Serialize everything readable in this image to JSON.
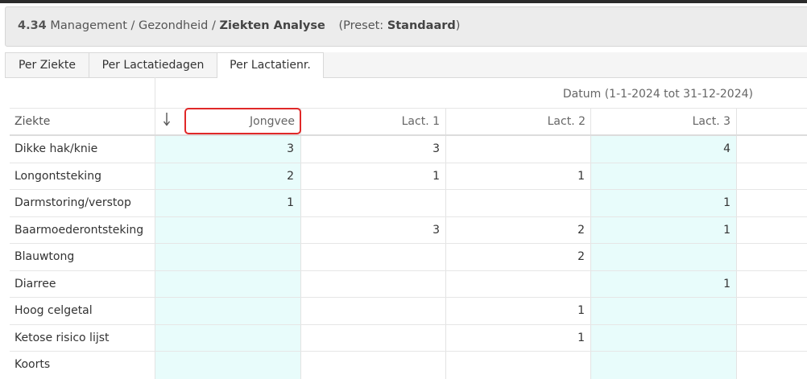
{
  "breadcrumb": {
    "number": "4.34",
    "section": "Management / Gezondheid /",
    "page": "Ziekten Analyse",
    "preset_prefix": "(Preset:",
    "preset_value": "Standaard",
    "preset_suffix": ")"
  },
  "tabs": [
    {
      "label": "Per Ziekte",
      "active": false
    },
    {
      "label": "Per Lactatiedagen",
      "active": false
    },
    {
      "label": "Per Lactatienr.",
      "active": true
    }
  ],
  "table": {
    "group_header": "Datum (1-1-2024 tot 31-12-2024)",
    "row_header": "Ziekte",
    "sort_icon": "arrow-down-icon",
    "columns": [
      "Jongvee",
      "Lact. 1",
      "Lact. 2",
      "Lact. 3"
    ],
    "rows": [
      {
        "label": "Dikke hak/knie",
        "values": [
          "3",
          "3",
          "",
          "4"
        ]
      },
      {
        "label": "Longontsteking",
        "values": [
          "2",
          "1",
          "1",
          ""
        ]
      },
      {
        "label": "Darmstoring/verstop",
        "values": [
          "1",
          "",
          "",
          "1"
        ]
      },
      {
        "label": "Baarmoederontsteking",
        "values": [
          "",
          "3",
          "2",
          "1"
        ]
      },
      {
        "label": "Blauwtong",
        "values": [
          "",
          "",
          "2",
          ""
        ]
      },
      {
        "label": "Diarree",
        "values": [
          "",
          "",
          "",
          "1"
        ]
      },
      {
        "label": "Hoog celgetal",
        "values": [
          "",
          "",
          "1",
          ""
        ]
      },
      {
        "label": "Ketose risico lijst",
        "values": [
          "",
          "",
          "1",
          ""
        ]
      },
      {
        "label": "Koorts",
        "values": [
          "",
          "",
          "",
          ""
        ]
      }
    ]
  },
  "colors": {
    "highlight_column_bg": "#e8fcfb",
    "annotation_border": "#e02828"
  }
}
